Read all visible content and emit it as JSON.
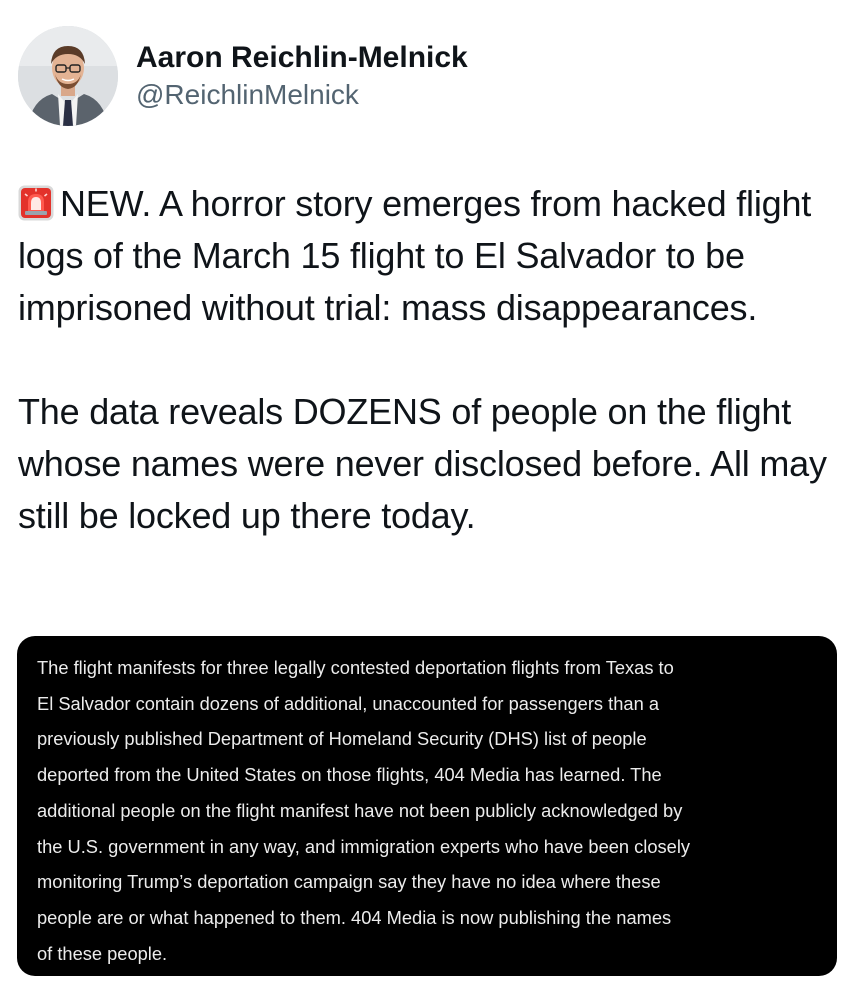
{
  "author": {
    "display_name": "Aaron Reichlin-Melnick",
    "handle": "@ReichlinMelnick",
    "avatar_icon": "profile-photo"
  },
  "tweet": {
    "emoji": "police-car-light-siren",
    "paragraphs": [
      "NEW. A horror story emerges from hacked flight logs of the March 15 flight to El Salvador to be imprisoned without trial: mass disappearances.",
      "The data reveals DOZENS of people on the flight whose names were never disclosed before. All may still be locked up there today."
    ]
  },
  "media": {
    "background": "#000000",
    "lines": [
      "The flight manifests for three legally contested deportation flights from Texas to",
      "El Salvador contain dozens of additional, unaccounted for passengers than a",
      "previously published Department of Homeland Security (DHS) list of people",
      "deported from the United States on those flights, 404 Media has learned. The",
      "additional people on the flight manifest have not been publicly acknowledged by",
      "the U.S. government in any way, and immigration experts who have been closely",
      "monitoring Trump’s deportation campaign say they have no idea where these",
      "people are or what happened to them. 404 Media is now publishing the names",
      "of these people."
    ]
  },
  "colors": {
    "text": "#0f1419",
    "secondary": "#536471",
    "media_text": "#ececec"
  }
}
